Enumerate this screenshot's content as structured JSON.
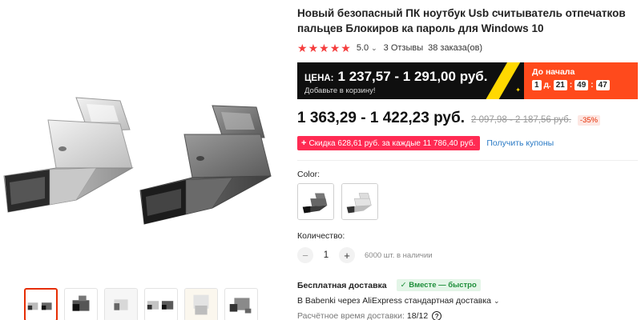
{
  "product": {
    "title": "Новый безопасный ПК ноутбук Usb считыватель отпечатков пальцев Блокиров ка пароль для Windows 10",
    "rating": "5.0",
    "reviews": "3 Отзывы",
    "orders": "38 заказа(ов)"
  },
  "promo": {
    "price_label": "ЦЕНА:",
    "price_range": "1 237,57 - 1 291,00 руб.",
    "add_to_cart_hint": "Добавьте в корзину!",
    "countdown_label": "До начала",
    "countdown": {
      "days": "1",
      "days_unit": "д.",
      "hours": "21",
      "minutes": "49",
      "seconds": "47",
      "sep": ":"
    },
    "colors": {
      "left_bg": "#0f0f0f",
      "right_bg": "#ff4a1c",
      "ribbon": "#ffd800"
    }
  },
  "pricing": {
    "current": "1 363,29 - 1 422,23 руб.",
    "old": "2 097,98 - 2 187,56 руб.",
    "discount": "-35%"
  },
  "coupon": {
    "plus": "+",
    "text": "Скидка 628,61 руб. за каждые 11 786,40 руб.",
    "link": "Получить купоны"
  },
  "variants": {
    "label": "Color:",
    "options": [
      "dark-gray-sensor",
      "silver-sensor"
    ]
  },
  "quantity": {
    "label": "Количество:",
    "minus": "−",
    "value": "1",
    "plus": "+",
    "stock": "6000 шт. в наличии"
  },
  "delivery": {
    "title": "Бесплатная доставка",
    "badge": "✓ Вместе — быстро",
    "description": "В Babenki через AliExpress стандартная доставка",
    "eta_label": "Расчётное время доставки:",
    "eta_value": "18/12",
    "help": "?"
  },
  "gallery": {
    "thumbnails": [
      "both-sensors",
      "dark-sensor",
      "silver-sensor-white",
      "both-sensors-alt",
      "silver-sensor-top",
      "dark-sensor-angle"
    ],
    "active_index": 0
  },
  "icons": {
    "star": "star-icon",
    "chevron": "chevron-down-icon",
    "help": "help-circle-icon"
  },
  "accent_colors": {
    "star": "#f53d3d",
    "discount": "#e62e04",
    "coupon": "#ff2b53",
    "link": "#2a7ac5",
    "delivery_badge": "#1f8f3b"
  }
}
